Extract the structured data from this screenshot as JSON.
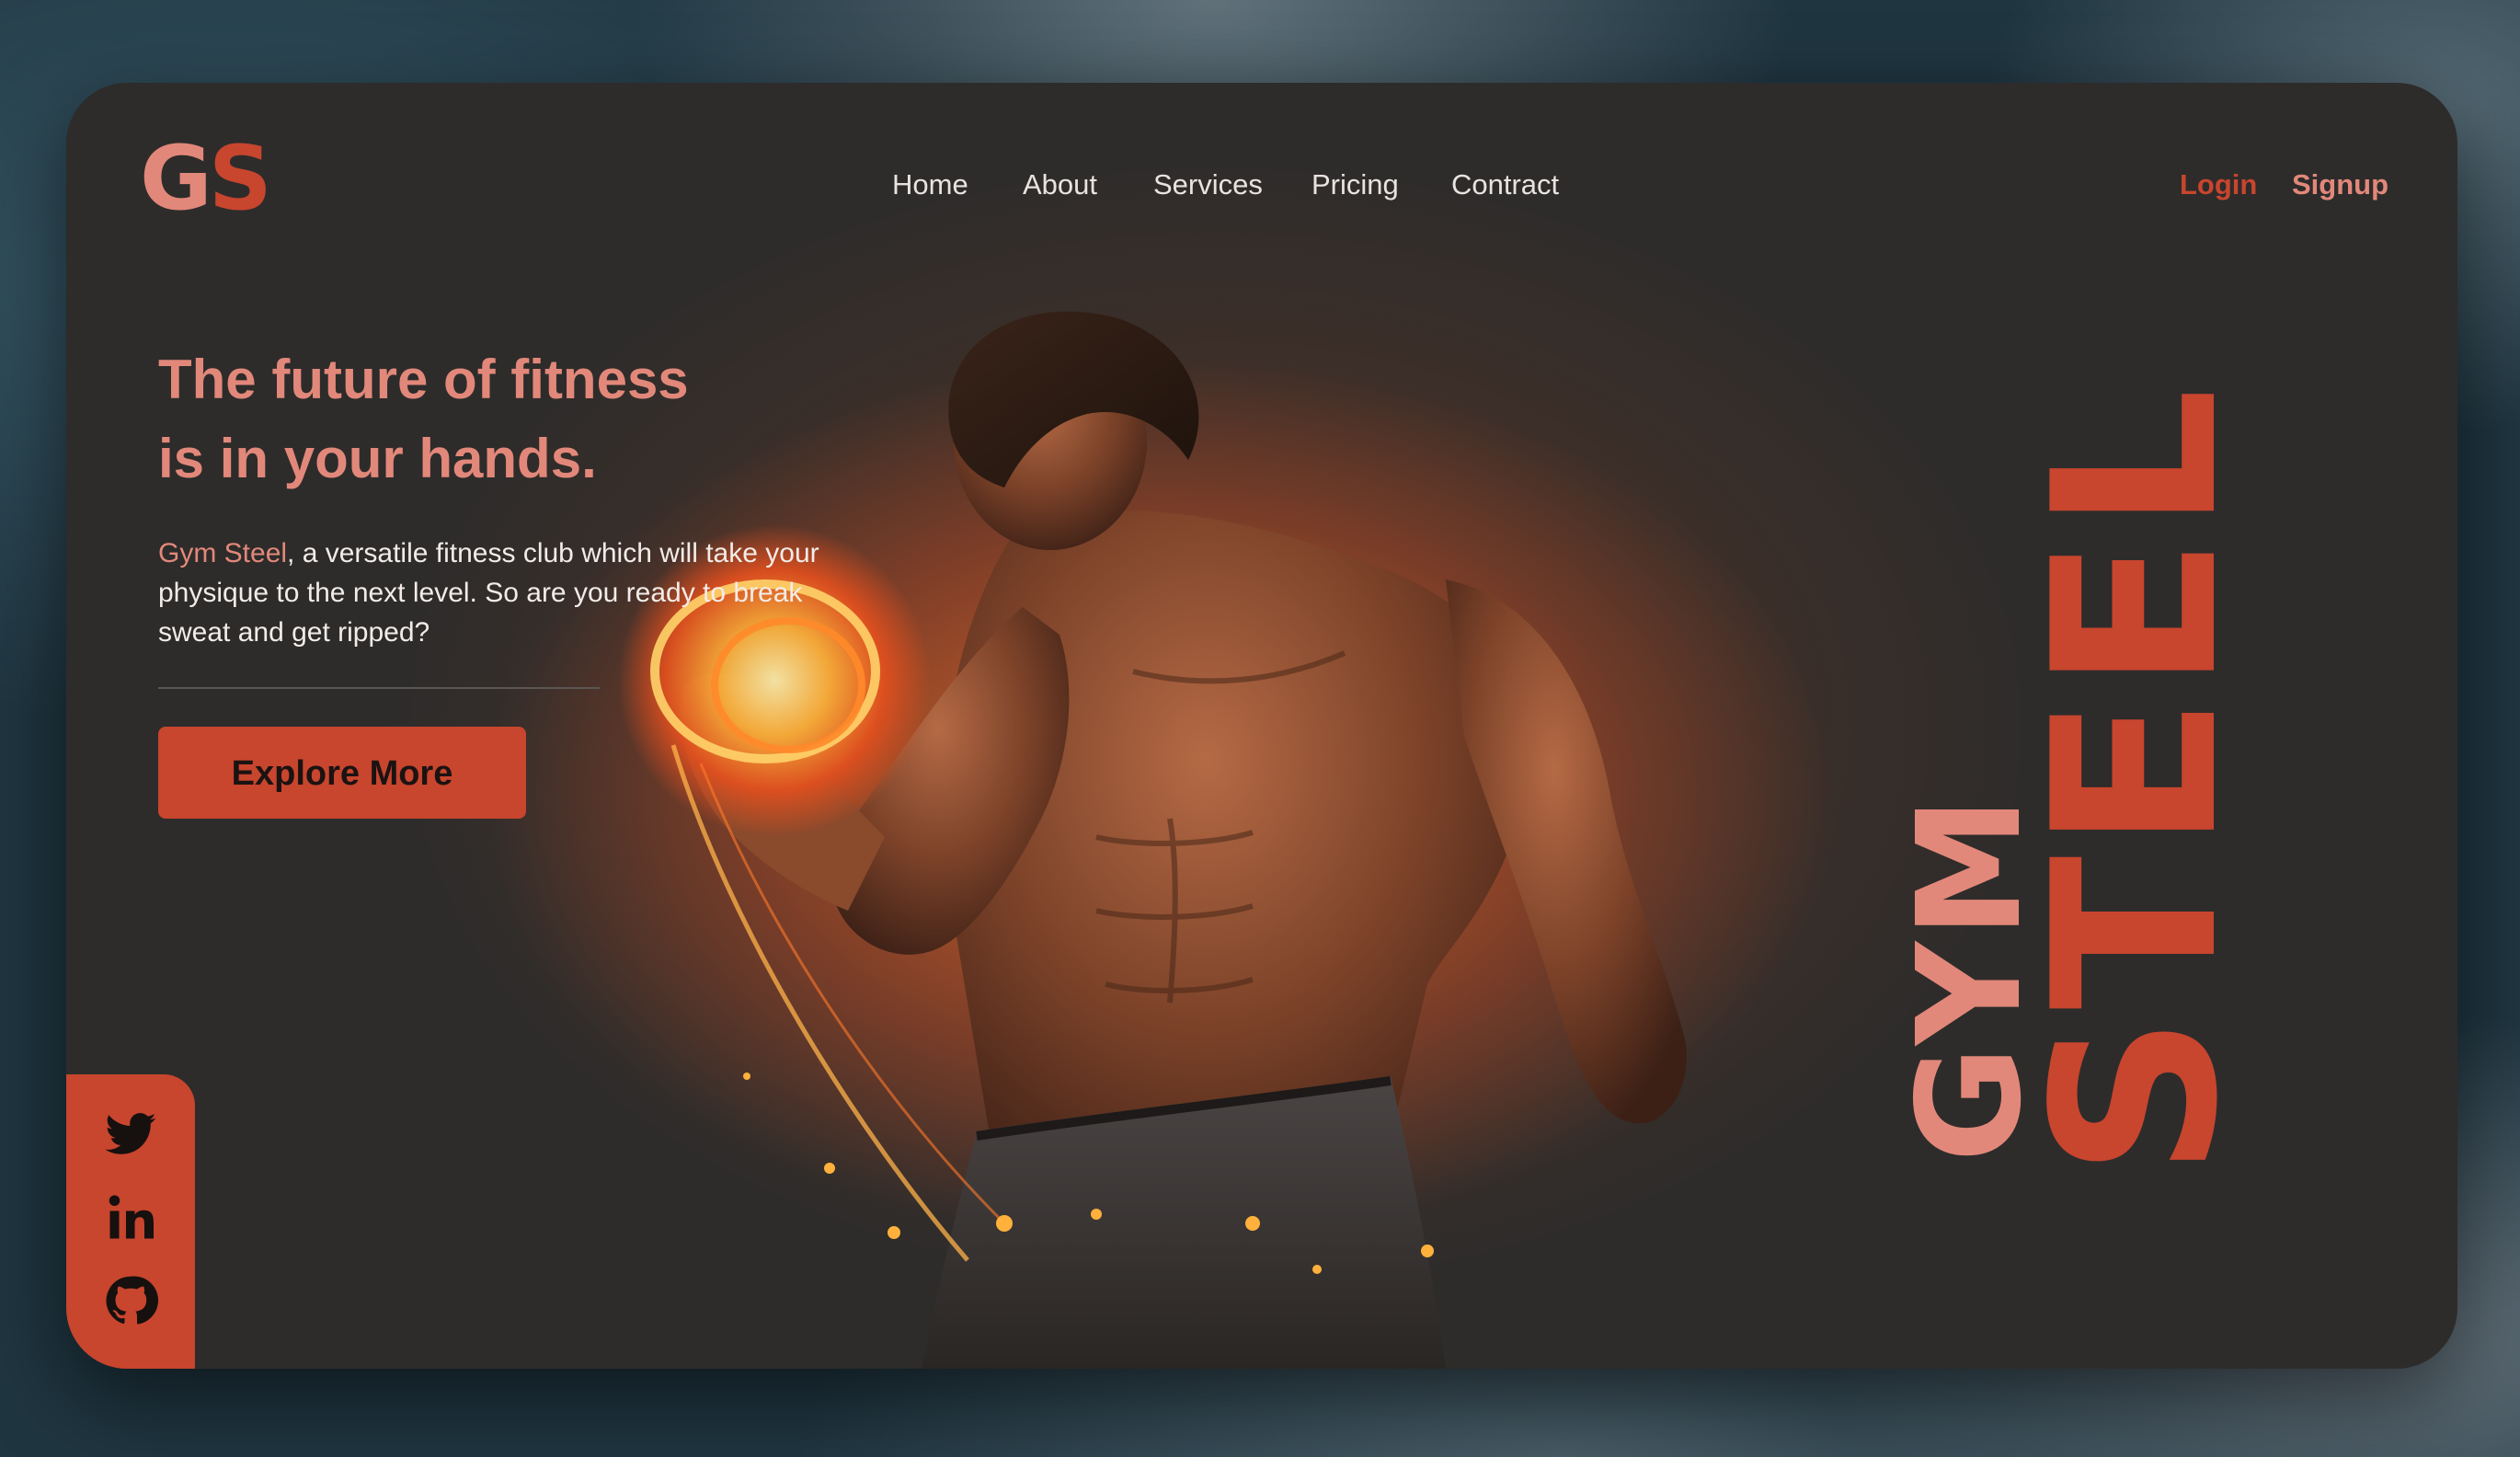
{
  "logo": {
    "g": "G",
    "s": "S"
  },
  "nav": {
    "items": [
      "Home",
      "About",
      "Services",
      "Pricing",
      "Contract"
    ]
  },
  "auth": {
    "login": "Login",
    "signup": "Signup"
  },
  "hero": {
    "headline_line1": "The future of fitness",
    "headline_line2": "is in your hands.",
    "brand_name": "Gym Steel",
    "description": ", a versatile fitness club which will take your physique to the next level. So are you ready to break sweat and get ripped?",
    "cta": "Explore More"
  },
  "vertical_brand": {
    "gym": "GYM",
    "steel": "STEEL"
  },
  "social": [
    "twitter-icon",
    "linkedin-icon",
    "github-icon"
  ],
  "colors": {
    "accent": "#c8452e",
    "accent_light": "#e2887a",
    "card_bg": "#2d2c2b",
    "glow": "#e86e28"
  }
}
